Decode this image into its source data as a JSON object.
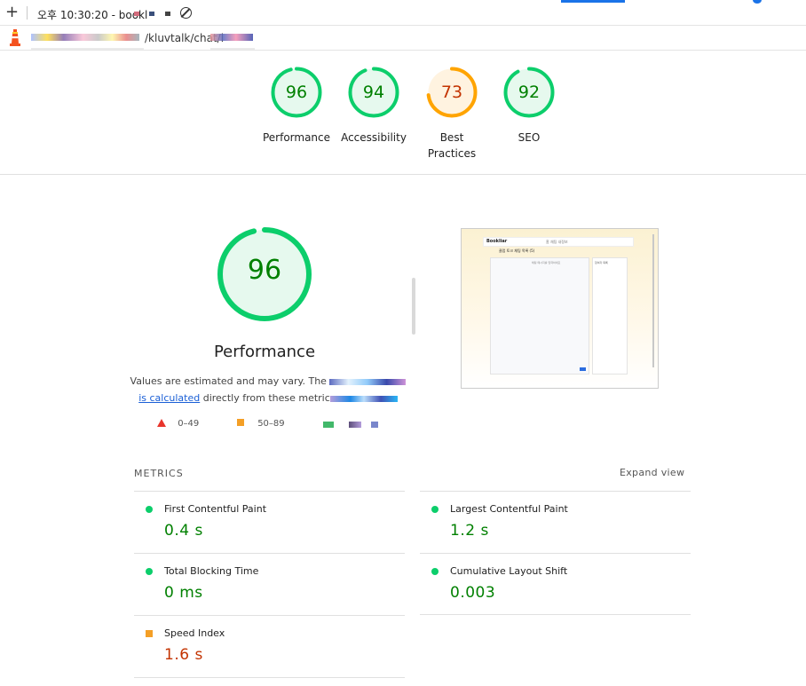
{
  "browser": {
    "new_tab_symbol": "+",
    "tab_title": "오후 10:30:20 - bookl",
    "url_visible": "/kluvtalk/chat/l"
  },
  "summary": [
    {
      "score": 96,
      "label": "Performance",
      "rating": "pass"
    },
    {
      "score": 94,
      "label": "Accessibility",
      "rating": "pass"
    },
    {
      "score": 73,
      "label": "Best Practices",
      "rating": "average"
    },
    {
      "score": 92,
      "label": "SEO",
      "rating": "pass"
    }
  ],
  "performance": {
    "score": 96,
    "title": "Performance",
    "desc_line1": "Values are estimated and may vary. The ",
    "desc_link": "is calculated",
    "desc_line2": " directly from these metric",
    "legend": [
      {
        "range": "0–49",
        "shape": "triangle",
        "color": "#e8352c"
      },
      {
        "range": "50–89",
        "shape": "square",
        "color": "#f49f26"
      }
    ]
  },
  "thumbnail": {
    "brand": "Bookliar",
    "nav_links": "홈     채팅     내정보",
    "heading": "클럽 토크 채팅 목록 (5)",
    "panel_text": "채팅 메시지를 입력하세요",
    "side_text": "참여자 목록"
  },
  "metrics": {
    "heading": "METRICS",
    "expand_label": "Expand view",
    "items": [
      {
        "name": "First Contentful Paint",
        "value": "0.4 s",
        "rating": "pass"
      },
      {
        "name": "Largest Contentful Paint",
        "value": "1.2 s",
        "rating": "pass"
      },
      {
        "name": "Total Blocking Time",
        "value": "0 ms",
        "rating": "pass"
      },
      {
        "name": "Cumulative Layout Shift",
        "value": "0.003",
        "rating": "pass"
      },
      {
        "name": "Speed Index",
        "value": "1.6 s",
        "rating": "average"
      }
    ]
  },
  "colors": {
    "pass": "#0cce6b",
    "pass_text": "#008000",
    "pass_fill": "#e6f9ee",
    "average": "#ffa400",
    "average_text": "#c33300",
    "average_fill": "#fff3e0",
    "fail": "#e8352c",
    "link": "#1a5fd6"
  }
}
